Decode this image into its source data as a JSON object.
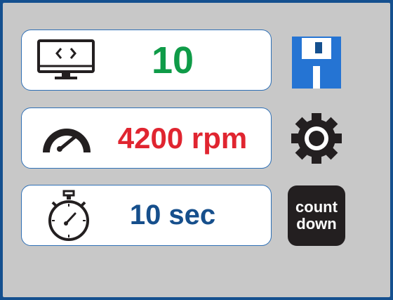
{
  "rows": [
    {
      "value": "10",
      "value_color": "#0f9b48",
      "icon": "code-monitor-icon"
    },
    {
      "value": "4200 rpm",
      "value_color": "#e02530",
      "icon": "speedometer-icon"
    },
    {
      "value": "10 sec",
      "value_color": "#164f8c",
      "icon": "stopwatch-icon"
    }
  ],
  "actions": {
    "save_icon": "floppy-disk-icon",
    "settings_icon": "gear-icon",
    "countdown": {
      "line1": "count",
      "line2": "down"
    }
  },
  "colors": {
    "background": "#15508f",
    "panel": "#c8c8c8",
    "card_border": "#2e6fb5",
    "save_blue": "#2574d3",
    "countdown_button": "#231f20"
  }
}
